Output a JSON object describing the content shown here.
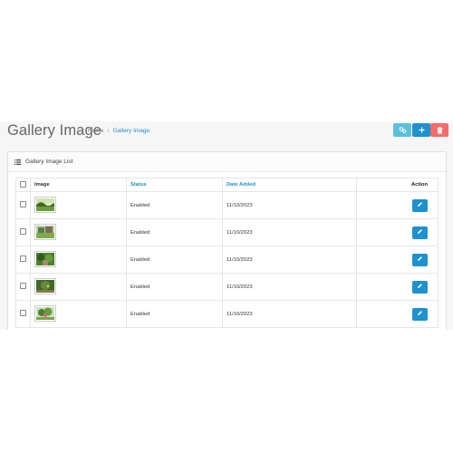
{
  "page": {
    "title": "Gallery Image",
    "breadcrumb": [
      {
        "label": "Home"
      },
      {
        "label": "Gallery Image"
      }
    ]
  },
  "header_buttons": [
    {
      "icon": "filter-icon",
      "color": "#5bc0de"
    },
    {
      "icon": "plus-icon",
      "color": "#1e91cf"
    },
    {
      "icon": "trash-icon",
      "color": "#f56b6b"
    }
  ],
  "panel": {
    "title": "Gallery Image List",
    "icon": "list-icon"
  },
  "table": {
    "columns": {
      "image": "Image",
      "status": "Status",
      "date_added": "Date Added",
      "action": "Action"
    },
    "rows": [
      {
        "status": "Enabled",
        "date_added": "11/10/2023"
      },
      {
        "status": "Enabled",
        "date_added": "11/10/2023"
      },
      {
        "status": "Enabled",
        "date_added": "11/10/2023"
      },
      {
        "status": "Enabled",
        "date_added": "11/10/2023"
      },
      {
        "status": "Enabled",
        "date_added": "11/10/2023"
      }
    ]
  },
  "colors": {
    "accent": "#1e91cf",
    "info": "#5bc0de",
    "danger": "#f56b6b"
  }
}
